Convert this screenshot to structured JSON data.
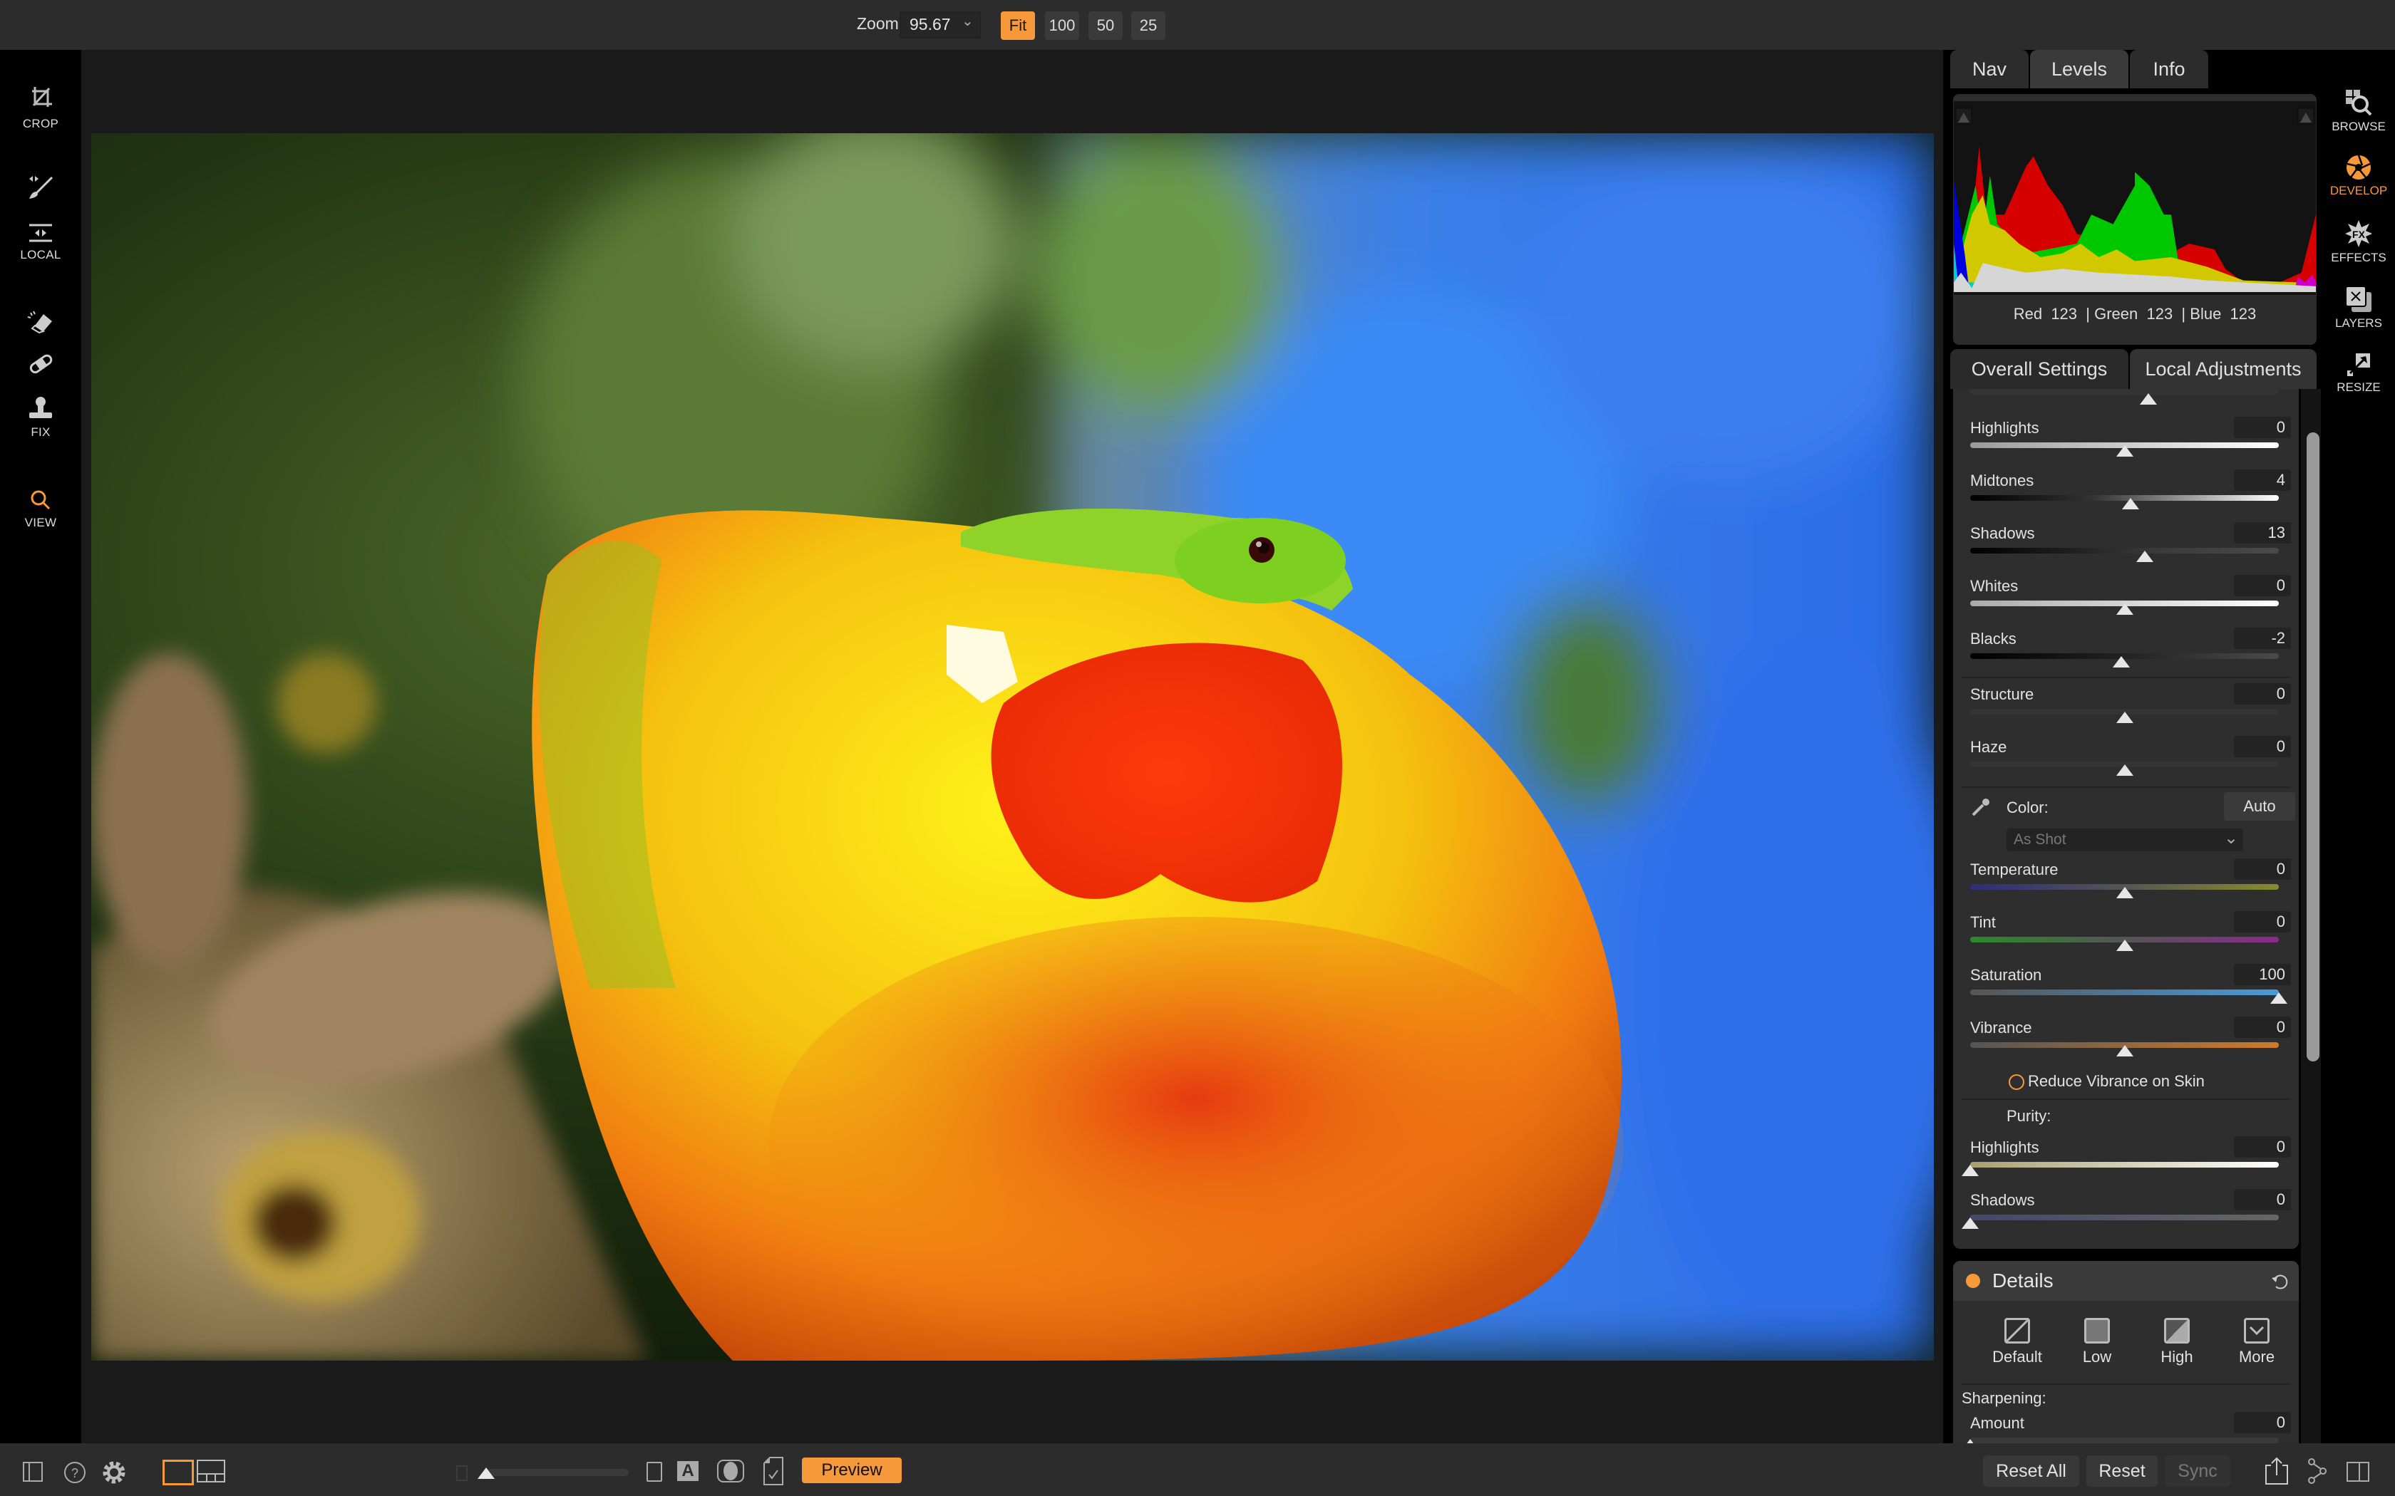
{
  "topbar": {
    "zoom_label": "Zoom",
    "zoom_value": "95.67",
    "zoom_presets": [
      {
        "label": "Fit",
        "active": true
      },
      {
        "label": "100",
        "active": false
      },
      {
        "label": "50",
        "active": false
      },
      {
        "label": "25",
        "active": false
      }
    ]
  },
  "left_tools": [
    {
      "label": "CROP",
      "icon": "crop-icon"
    },
    {
      "label": "",
      "icon": "brush-icon"
    },
    {
      "label": "LOCAL",
      "icon": "local-gradient-icon"
    },
    {
      "label": "",
      "icon": "eraser-icon"
    },
    {
      "label": "",
      "icon": "bandage-icon"
    },
    {
      "label": "FIX",
      "icon": "clone-stamp-icon"
    },
    {
      "label": "VIEW",
      "icon": "search-icon",
      "active": true
    }
  ],
  "info_tabs": [
    {
      "label": "Nav",
      "active": false
    },
    {
      "label": "Levels",
      "active": true
    },
    {
      "label": "Info",
      "active": false
    }
  ],
  "histogram": {
    "readout": {
      "red_label": "Red",
      "red": "123",
      "green_label": "Green",
      "green": "123",
      "blue_label": "Blue",
      "blue": "123"
    }
  },
  "settings_tabs": [
    {
      "label": "Overall Settings",
      "active": false
    },
    {
      "label": "Local Adjustments",
      "active": true
    }
  ],
  "tone_sliders": [
    {
      "label": "Highlights",
      "value": "0",
      "min": -100,
      "max": 100,
      "num": 0
    },
    {
      "label": "Midtones",
      "value": "4",
      "min": -100,
      "max": 100,
      "num": 4
    },
    {
      "label": "Shadows",
      "value": "13",
      "min": -100,
      "max": 100,
      "num": 13
    },
    {
      "label": "Whites",
      "value": "0",
      "min": -100,
      "max": 100,
      "num": 0
    },
    {
      "label": "Blacks",
      "value": "-2",
      "min": -100,
      "max": 100,
      "num": -2
    }
  ],
  "detail_sliders": [
    {
      "label": "Structure",
      "value": "0",
      "min": -100,
      "max": 100,
      "num": 0
    },
    {
      "label": "Haze",
      "value": "0",
      "min": -100,
      "max": 100,
      "num": 0
    }
  ],
  "color": {
    "label": "Color:",
    "auto_label": "Auto",
    "white_balance": "As Shot",
    "sliders": [
      {
        "label": "Temperature",
        "value": "0",
        "min": -100,
        "max": 100,
        "num": 0
      },
      {
        "label": "Tint",
        "value": "0",
        "min": -100,
        "max": 100,
        "num": 0
      },
      {
        "label": "Saturation",
        "value": "100",
        "min": -100,
        "max": 100,
        "num": 100
      },
      {
        "label": "Vibrance",
        "value": "0",
        "min": -100,
        "max": 100,
        "num": 0
      }
    ],
    "reduce_vibrance_label": "Reduce Vibrance on Skin",
    "reduce_vibrance_checked": false
  },
  "purity": {
    "label": "Purity:",
    "sliders": [
      {
        "label": "Highlights",
        "value": "0",
        "min": 0,
        "max": 100,
        "num": 0
      },
      {
        "label": "Shadows",
        "value": "0",
        "min": 0,
        "max": 100,
        "num": 0
      }
    ]
  },
  "details": {
    "title": "Details",
    "presets": [
      {
        "label": "Default",
        "icon": "default-preset-icon"
      },
      {
        "label": "Low",
        "icon": "low-preset-icon"
      },
      {
        "label": "High",
        "icon": "high-preset-icon"
      },
      {
        "label": "More",
        "icon": "more-chevron-icon"
      }
    ],
    "sharpening_label": "Sharpening:",
    "amount_label": "Amount",
    "amount_value": "0"
  },
  "modes": [
    {
      "label": "BROWSE",
      "icon": "browse-icon",
      "active": false
    },
    {
      "label": "DEVELOP",
      "icon": "aperture-icon",
      "active": true
    },
    {
      "label": "EFFECTS",
      "icon": "fx-icon",
      "active": false
    },
    {
      "label": "LAYERS",
      "icon": "layers-icon",
      "active": false
    },
    {
      "label": "RESIZE",
      "icon": "resize-icon",
      "active": false
    }
  ],
  "bottombar": {
    "preview_label": "Preview",
    "reset_all_label": "Reset All",
    "reset_label": "Reset",
    "sync_label": "Sync",
    "thumb_size_fraction": 0.0
  },
  "colors": {
    "accent": "#f7993a",
    "panel": "#2e2e2e",
    "bar": "#2c2c2c"
  }
}
